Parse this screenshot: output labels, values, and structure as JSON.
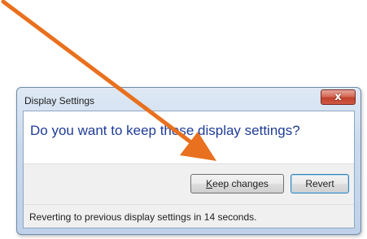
{
  "dialog": {
    "title": "Display Settings",
    "close_glyph": "x",
    "close_icon": "close-icon",
    "question": "Do you want to keep these display settings?",
    "keep_button": {
      "accelerator": "K",
      "rest": "eep changes"
    },
    "revert_button": {
      "label": "Revert"
    },
    "status": "Reverting to previous display settings in 14 seconds.",
    "countdown_seconds": 14
  },
  "annotation": {
    "icon": "pointer-arrow",
    "color": "#e8701e"
  },
  "colors": {
    "question_text": "#1f3c96",
    "close_button": "#c7503b",
    "default_button_border": "#3c7fb1"
  }
}
